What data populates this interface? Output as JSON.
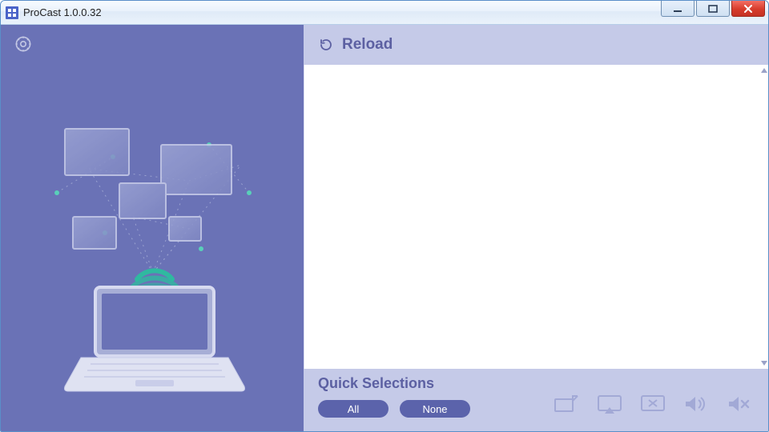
{
  "window": {
    "title": "ProCast 1.0.0.32"
  },
  "header": {
    "reload_label": "Reload"
  },
  "quick_selections": {
    "title": "Quick Selections",
    "all_label": "All",
    "none_label": "None"
  },
  "icons": {
    "app": "procast-app-icon",
    "gear": "gear-icon",
    "reload": "reload-icon",
    "display_fit": "display-fit-icon",
    "airplay": "airplay-icon",
    "disconnect": "disconnect-display-icon",
    "volume_on": "volume-on-icon",
    "volume_mute": "volume-mute-icon",
    "minimize": "minimize-icon",
    "maximize": "maximize-icon",
    "close": "close-icon"
  }
}
